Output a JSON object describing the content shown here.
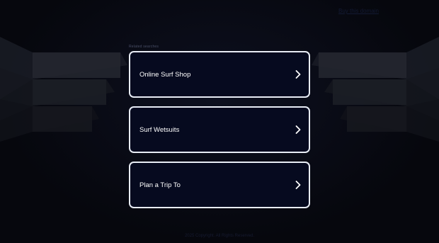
{
  "header": {
    "top_link": "Buy this domain"
  },
  "main": {
    "related_label": "Related searches",
    "items": [
      {
        "label": "Online Surf Shop",
        "icon": "chevron-right-icon"
      },
      {
        "label": "Surf Wetsuits",
        "icon": "chevron-right-icon"
      },
      {
        "label": "Plan a Trip To",
        "icon": "chevron-right-icon"
      }
    ]
  },
  "footer": {
    "text": "2025 Copyright. All Rights Reserved."
  },
  "colors": {
    "background": "#07080f",
    "card_background": "#060a1f",
    "card_border": "#e8ecf5",
    "card_text": "#ffffff"
  }
}
